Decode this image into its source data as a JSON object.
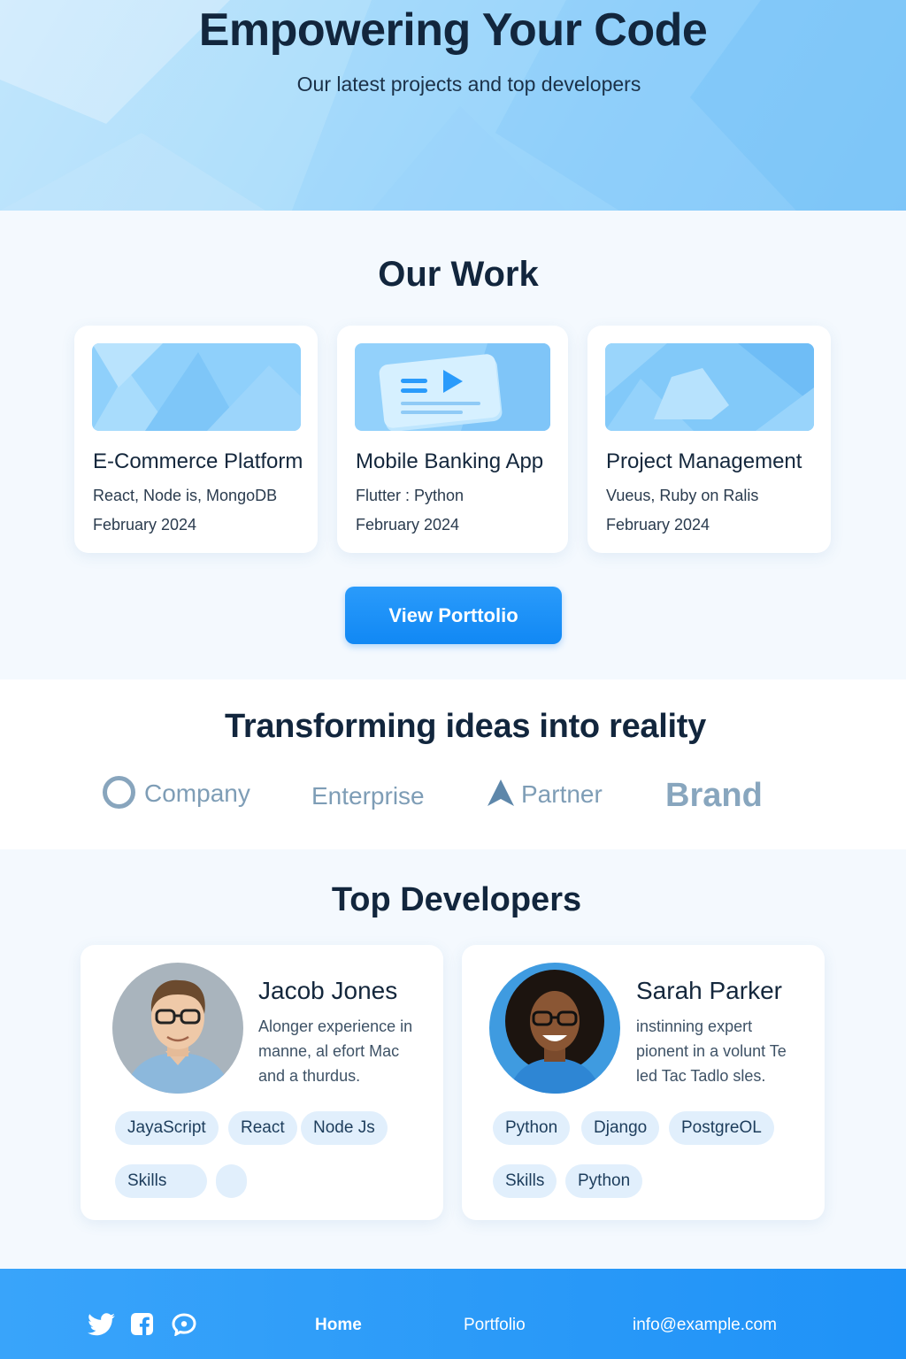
{
  "hero": {
    "title": "Empowering Your Code",
    "subtitle": "Our latest projects and top developers"
  },
  "work": {
    "title": "Our Work",
    "projects": [
      {
        "title": "E-Commerce Platform",
        "stack": "React, Node is, MongoDB",
        "date": "February 2024"
      },
      {
        "title": "Mobile Banking App",
        "stack": "Flutter : Python",
        "date": "February 2024"
      },
      {
        "title": "Project Management",
        "stack": "Vueus, Ruby on Ralis",
        "date": "February 2024"
      }
    ],
    "button_label": "View Porttolio"
  },
  "clients": {
    "title": "Transforming ideas into reality",
    "logos": [
      "Company",
      "Enterprise",
      "Partner",
      "Brand"
    ]
  },
  "developers": {
    "title": "Top Developers",
    "people": [
      {
        "name": "Jacob Jones",
        "bio": "Alonger experience in manne, al efort Mac and a thurdus.",
        "tags": [
          "JayaScript",
          "React",
          "Node Js",
          "Skills",
          ""
        ]
      },
      {
        "name": "Sarah Parker",
        "bio": "instinning expert pionent in a volunt Te led Tac Tadlo sles.",
        "tags": [
          "Python",
          "Django",
          "PostgreOL",
          "Skills",
          "Python"
        ]
      }
    ]
  },
  "footer": {
    "social_icons": [
      "twitter-icon",
      "facebook-icon",
      "chat-icon"
    ],
    "links": [
      "Home",
      "Portfolio"
    ],
    "email": "info@example.com"
  },
  "colors": {
    "accent": "#1a8ff6",
    "tag_bg": "#e1effc",
    "heading": "#12263d"
  }
}
